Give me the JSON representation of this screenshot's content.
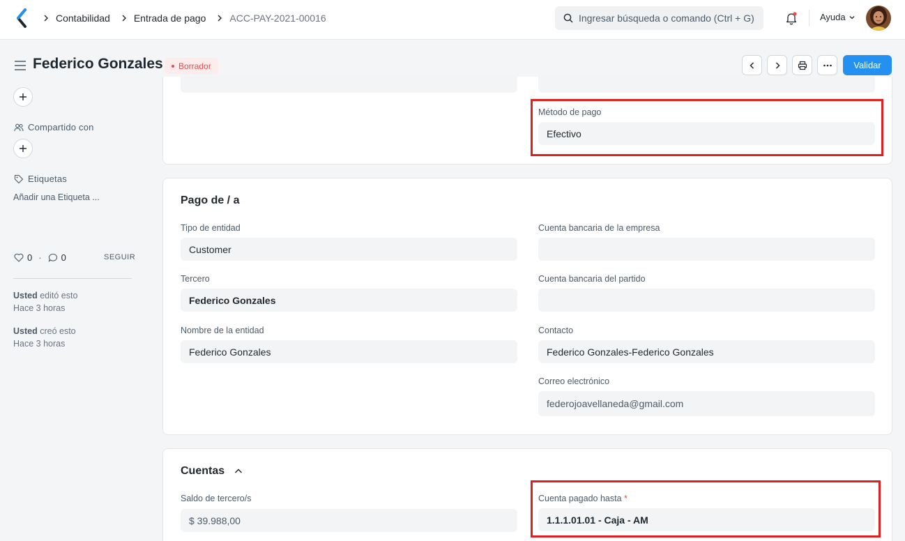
{
  "navbar": {
    "breadcrumbs": [
      "Contabilidad",
      "Entrada de pago",
      "ACC-PAY-2021-00016"
    ],
    "search_placeholder": "Ingresar búsqueda o comando (Ctrl + G)",
    "help_label": "Ayuda"
  },
  "page": {
    "title": "Federico Gonzales",
    "status": "Borrador",
    "primary_action": "Validar"
  },
  "sidebar": {
    "shared_with_label": "Compartido con",
    "tags_label": "Etiquetas",
    "add_tag_text": "Añadir una Etiqueta ...",
    "likes": "0",
    "comments": "0",
    "follow_label": "SEGUIR",
    "activity": [
      {
        "user": "Usted",
        "action": "editó esto",
        "time": "Hace 3 horas"
      },
      {
        "user": "Usted",
        "action": "creó esto",
        "time": "Hace 3 horas"
      }
    ]
  },
  "card_top": {
    "payment_method_label": "Método de pago",
    "payment_method_value": "Efectivo"
  },
  "card_party": {
    "title": "Pago de / a",
    "party_type_label": "Tipo de entidad",
    "party_type_value": "Customer",
    "party_label": "Tercero",
    "party_value": "Federico Gonzales",
    "party_name_label": "Nombre de la entidad",
    "party_name_value": "Federico Gonzales",
    "company_bank_label": "Cuenta bancaria de la empresa",
    "company_bank_value": "",
    "party_bank_label": "Cuenta bancaria del partido",
    "party_bank_value": "",
    "contact_label": "Contacto",
    "contact_value": "Federico Gonzales-Federico Gonzales",
    "email_label": "Correo electrónico",
    "email_value": "federojoavellaneda@gmail.com"
  },
  "card_accounts": {
    "title": "Cuentas",
    "party_balance_label": "Saldo de tercero/s",
    "party_balance_value": "$ 39.988,00",
    "paid_to_label": "Cuenta pagado hasta",
    "paid_to_required": "*",
    "paid_to_value": "1.1.1.01.01 - Caja - AM"
  },
  "colors": {
    "primary": "#2490ef",
    "highlight": "#e02020",
    "draft_badge": "#e24c4c"
  }
}
